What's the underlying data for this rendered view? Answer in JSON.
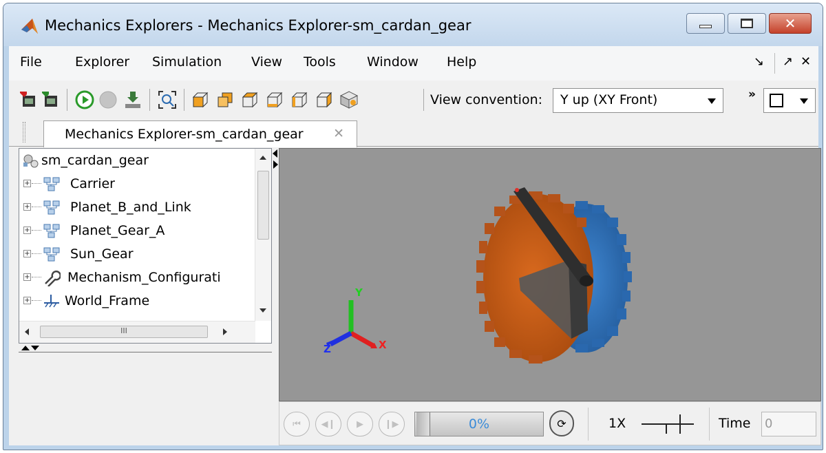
{
  "window": {
    "title": "Mechanics Explorers - Mechanics Explorer-sm_cardan_gear",
    "app_icon": "matlab-icon"
  },
  "menu": {
    "items": [
      "File",
      "Explorer",
      "Simulation",
      "View",
      "Tools",
      "Window",
      "Help"
    ]
  },
  "toolbar": {
    "view_convention_label": "View convention:",
    "view_convention_value": "Y up (XY Front)",
    "overflow_label": "»"
  },
  "tab": {
    "label": "Mechanics Explorer-sm_cardan_gear",
    "close_glyph": "✕"
  },
  "tree": {
    "root": "sm_cardan_gear",
    "items": [
      {
        "label": "Carrier",
        "icon": "subsystem-icon"
      },
      {
        "label": "Planet_B_and_Link",
        "icon": "subsystem-icon"
      },
      {
        "label": "Planet_Gear_A",
        "icon": "subsystem-icon"
      },
      {
        "label": "Sun_Gear",
        "icon": "subsystem-icon"
      },
      {
        "label": "Mechanism_Configurati",
        "icon": "wrench-icon"
      },
      {
        "label": "World_Frame",
        "icon": "ground-icon"
      }
    ],
    "hscroll_grip": "III"
  },
  "triad": {
    "x": "X",
    "y": "Y",
    "z": "Z"
  },
  "playback": {
    "progress_text": "0%",
    "progress_value": 0,
    "speed_label": "1X",
    "time_label": "Time",
    "time_value": "0"
  },
  "colors": {
    "viewport_bg": "#969696",
    "orange_gear": "#c25a15",
    "blue_gear": "#2f6db5",
    "link": "#2e2e2e",
    "progress_text": "#3a8bd8"
  }
}
